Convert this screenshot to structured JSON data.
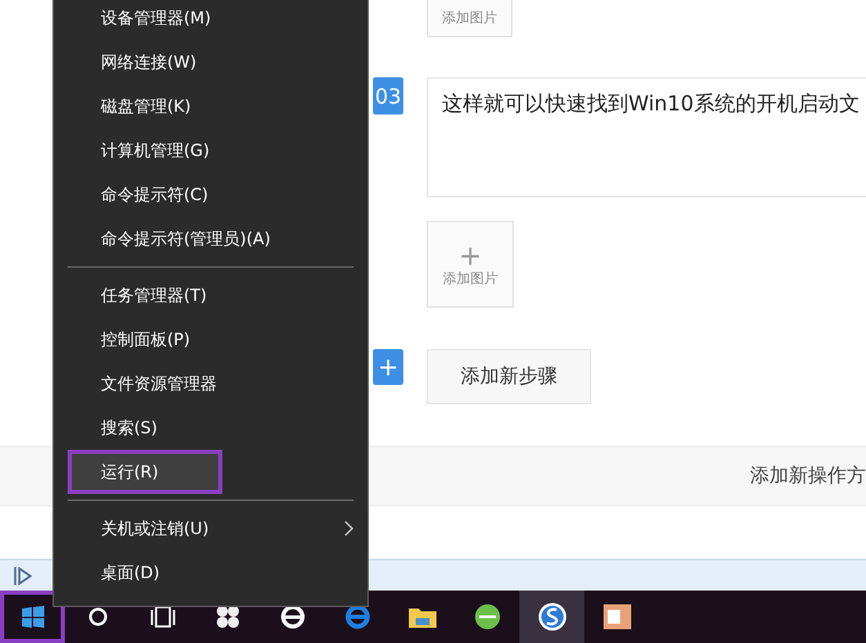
{
  "editor": {
    "top_image_card": {
      "label": "添加图片"
    },
    "step": {
      "number": "03",
      "text": "这样就可以快速找到Win10系统的开机启动文"
    },
    "image_card": {
      "plus": "+",
      "label": "添加图片"
    },
    "add_step": {
      "plus": "+",
      "label": "添加新步骤"
    },
    "add_method": {
      "label": "添加新操作方"
    }
  },
  "context_menu": {
    "sections": [
      [
        {
          "label": "设备管理器(M)",
          "kind": "item",
          "selected": false,
          "marked": false
        },
        {
          "label": "网络连接(W)",
          "kind": "item",
          "selected": false,
          "marked": false
        },
        {
          "label": "磁盘管理(K)",
          "kind": "item",
          "selected": false,
          "marked": false
        },
        {
          "label": "计算机管理(G)",
          "kind": "item",
          "selected": false,
          "marked": false
        },
        {
          "label": "命令提示符(C)",
          "kind": "item",
          "selected": false,
          "marked": false
        },
        {
          "label": "命令提示符(管理员)(A)",
          "kind": "item",
          "selected": false,
          "marked": false
        }
      ],
      [
        {
          "label": "任务管理器(T)",
          "kind": "item",
          "selected": false,
          "marked": false
        },
        {
          "label": "控制面板(P)",
          "kind": "item",
          "selected": false,
          "marked": false
        },
        {
          "label": "文件资源管理器",
          "kind": "item",
          "selected": false,
          "marked": false
        },
        {
          "label": "搜索(S)",
          "kind": "item",
          "selected": false,
          "marked": false
        },
        {
          "label": "运行(R)",
          "kind": "item",
          "selected": true,
          "marked": true
        }
      ],
      [
        {
          "label": "关机或注销(U)",
          "kind": "submenu",
          "selected": false,
          "marked": false
        },
        {
          "label": "桌面(D)",
          "kind": "item",
          "selected": false,
          "marked": false
        }
      ]
    ]
  },
  "taskbar": {
    "items": [
      {
        "kind": "start",
        "selected": false,
        "marked": true
      },
      {
        "kind": "cortana",
        "selected": false,
        "marked": false
      },
      {
        "kind": "taskview",
        "selected": false,
        "marked": false
      },
      {
        "kind": "pinwheel",
        "selected": false,
        "marked": false
      },
      {
        "kind": "ie",
        "selected": false,
        "marked": false
      },
      {
        "kind": "edge",
        "selected": false,
        "marked": false
      },
      {
        "kind": "folder",
        "selected": false,
        "marked": false
      },
      {
        "kind": "green",
        "selected": false,
        "marked": false
      },
      {
        "kind": "sogou",
        "selected": true,
        "marked": false
      },
      {
        "kind": "slides",
        "selected": false,
        "marked": false
      }
    ]
  }
}
